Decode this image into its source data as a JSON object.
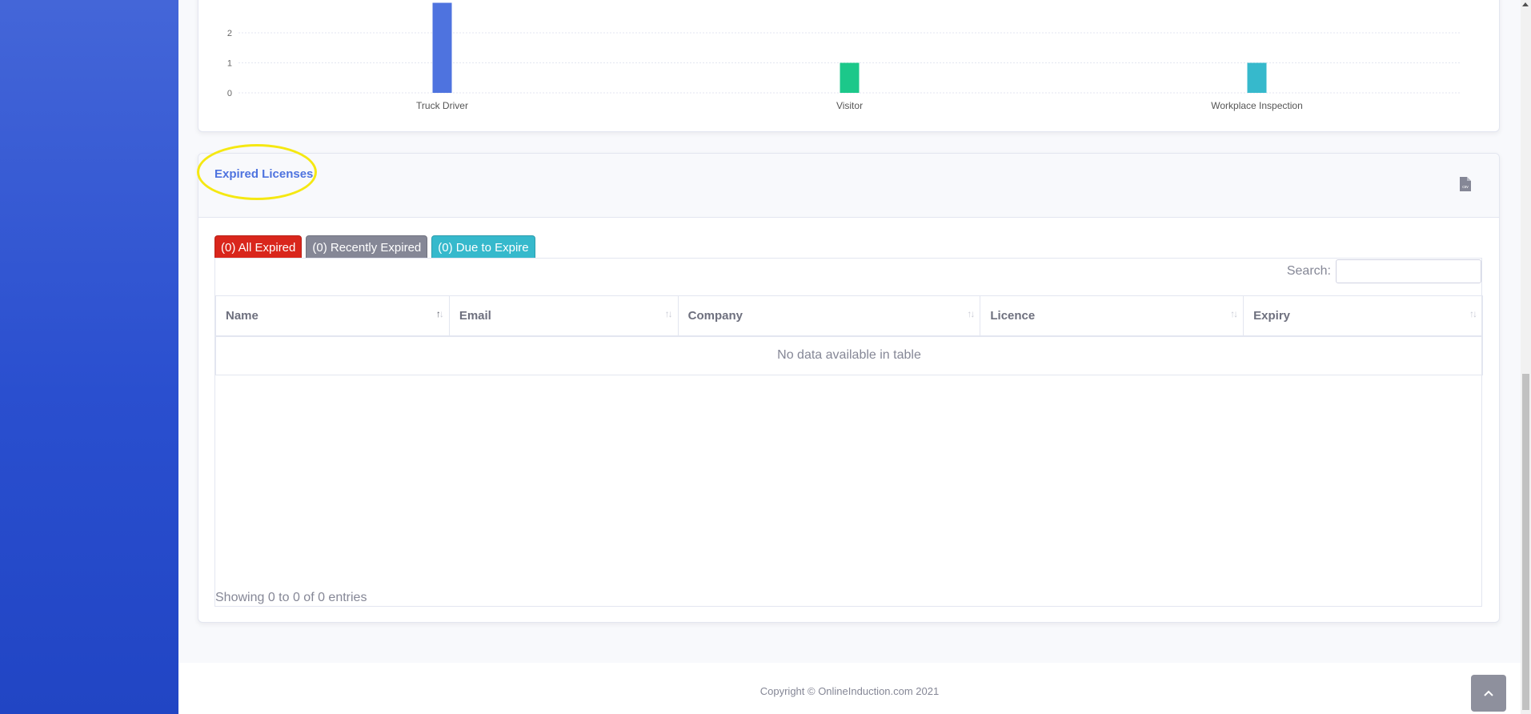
{
  "chart_data": {
    "type": "bar",
    "categories": [
      "Truck Driver",
      "Visitor",
      "Workplace Inspection"
    ],
    "values": [
      3,
      1,
      1
    ],
    "y_ticks": [
      "0",
      "1",
      "2"
    ],
    "ylim": [
      0,
      2.5
    ],
    "colors": [
      "#4e73df",
      "#1cc88a",
      "#36b9cc"
    ],
    "grid": true
  },
  "licenses": {
    "title": "Expired Licenses",
    "csv_icon": "csv-file-icon",
    "tabs": [
      {
        "label": "(0) All Expired",
        "color": "#d9261c"
      },
      {
        "label": "(0) Recently Expired",
        "color": "#858796"
      },
      {
        "label": "(0) Due to Expire",
        "color": "#36b9cc"
      }
    ],
    "search_label": "Search:",
    "search_value": "",
    "columns": [
      "Name",
      "Email",
      "Company",
      "Licence",
      "Expiry"
    ],
    "empty_message": "No data available in table",
    "info": "Showing 0 to 0 of 0 entries"
  },
  "footer": {
    "copyright": "Copyright © OnlineInduction.com 2021",
    "scroll_top_icon": "chevron-up-icon"
  },
  "colors": {
    "sidebar_top": "#4466d8",
    "sidebar_bottom": "#2145c4",
    "primary": "#4e73df",
    "highlight": "#f5e812"
  }
}
